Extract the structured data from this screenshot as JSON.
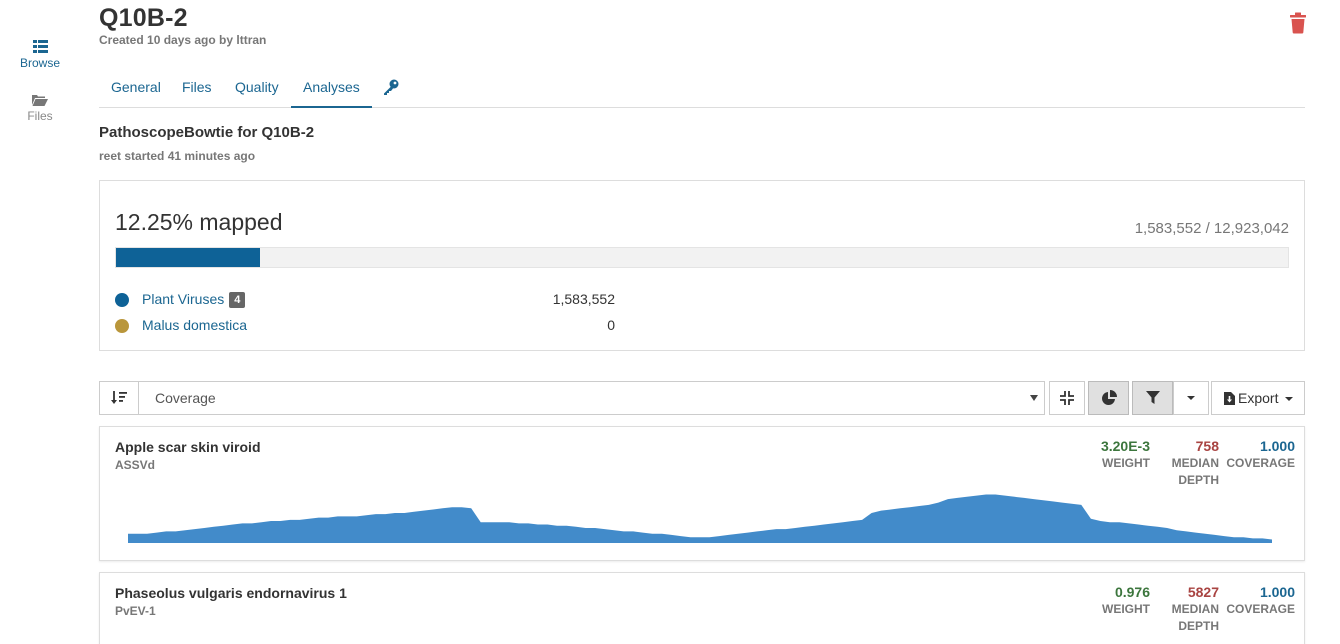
{
  "nav": {
    "browse_label": "Browse",
    "files_label": "Files"
  },
  "header": {
    "title": "Q10B-2",
    "subtitle": "Created 10 days ago by lttran"
  },
  "tabs": [
    {
      "label": "General"
    },
    {
      "label": "Files"
    },
    {
      "label": "Quality"
    },
    {
      "label": "Analyses"
    }
  ],
  "analysis": {
    "title": "PathoscopeBowtie for Q10B-2",
    "subtitle": "reet started 41 minutes ago"
  },
  "mapping": {
    "percent_label": "12.25% mapped",
    "count_label": "1,583,552 / 12,923,042",
    "fraction": 0.1225,
    "legend": [
      {
        "name": "Plant Viruses",
        "badge": "4",
        "value": "1,583,552",
        "color": "#0e6297"
      },
      {
        "name": "Malus domestica",
        "badge": "",
        "value": "0",
        "color": "#b9963b"
      }
    ]
  },
  "toolbar": {
    "sort_value": "Coverage",
    "export_label": "Export"
  },
  "colors": {
    "weight": "#3c763d",
    "depth": "#a94442",
    "coverage": "#1b6691",
    "chart_fill": "#428bca"
  },
  "hits": [
    {
      "name": "Apple scar skin viroid",
      "abbreviation": "ASSVd",
      "weight": "3.20E-3",
      "weight_label": "WEIGHT",
      "depth": "758",
      "depth_label": "MEDIAN",
      "depth_label2": "DEPTH",
      "coverage": "1.000",
      "coverage_label": "COVERAGE",
      "coverage_profile": [
        8,
        8,
        8,
        9,
        10,
        10,
        11,
        12,
        13,
        14,
        15,
        16,
        17,
        17,
        18,
        19,
        19,
        20,
        20,
        21,
        22,
        22,
        23,
        23,
        23,
        24,
        25,
        25,
        26,
        26,
        27,
        28,
        29,
        30,
        31,
        31,
        30,
        18,
        18,
        18,
        18,
        17,
        17,
        16,
        16,
        15,
        15,
        14,
        13,
        13,
        12,
        11,
        10,
        10,
        9,
        8,
        8,
        7,
        6,
        5,
        5,
        5,
        6,
        7,
        8,
        9,
        10,
        11,
        12,
        12,
        13,
        14,
        15,
        16,
        17,
        18,
        19,
        20,
        26,
        28,
        29,
        30,
        31,
        32,
        33,
        35,
        38,
        39,
        40,
        41,
        42,
        42,
        41,
        40,
        39,
        38,
        37,
        36,
        35,
        34,
        33,
        21,
        19,
        18,
        18,
        17,
        16,
        15,
        14,
        13,
        11,
        10,
        9,
        8,
        7,
        6,
        5,
        5,
        4,
        4,
        3
      ]
    },
    {
      "name": "Phaseolus vulgaris endornavirus 1",
      "abbreviation": "PvEV-1",
      "weight": "0.976",
      "weight_label": "WEIGHT",
      "depth": "5827",
      "depth_label": "MEDIAN",
      "depth_label2": "DEPTH",
      "coverage": "1.000",
      "coverage_label": "COVERAGE",
      "coverage_profile": []
    }
  ]
}
